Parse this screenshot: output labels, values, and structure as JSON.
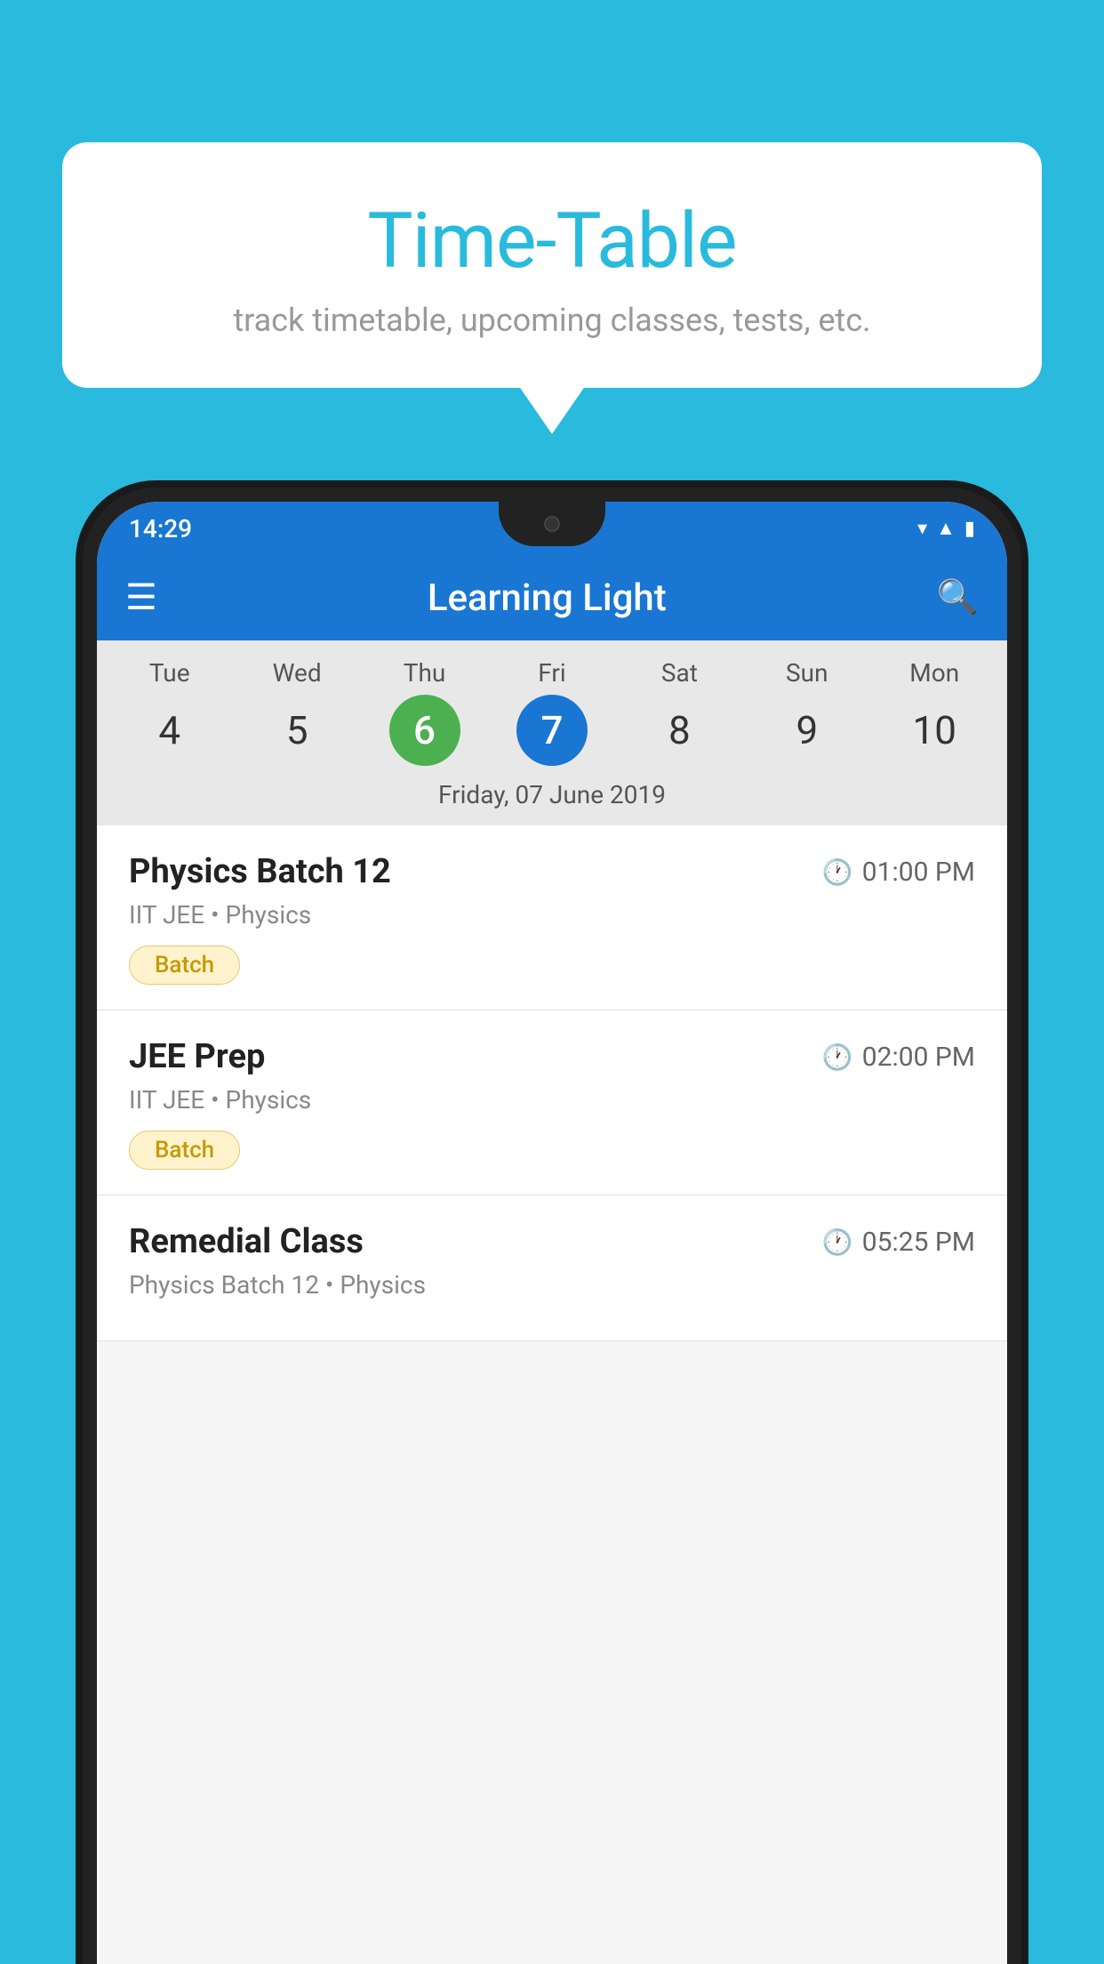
{
  "background_color": "#29BADE",
  "bubble": {
    "title": "Time-Table",
    "subtitle": "track timetable, upcoming classes, tests, etc."
  },
  "app_bar": {
    "title": "Learning Light",
    "menu_icon": "☰",
    "search_icon": "🔍"
  },
  "status_bar": {
    "time": "14:29"
  },
  "calendar": {
    "days": [
      {
        "name": "Tue",
        "number": "4",
        "state": "normal"
      },
      {
        "name": "Wed",
        "number": "5",
        "state": "normal"
      },
      {
        "name": "Thu",
        "number": "6",
        "state": "today"
      },
      {
        "name": "Fri",
        "number": "7",
        "state": "selected"
      },
      {
        "name": "Sat",
        "number": "8",
        "state": "normal"
      },
      {
        "name": "Sun",
        "number": "9",
        "state": "normal"
      },
      {
        "name": "Mon",
        "number": "10",
        "state": "normal"
      }
    ],
    "selected_date_label": "Friday, 07 June 2019"
  },
  "events": [
    {
      "name": "Physics Batch 12",
      "time": "01:00 PM",
      "subtitle": "IIT JEE • Physics",
      "badge": "Batch"
    },
    {
      "name": "JEE Prep",
      "time": "02:00 PM",
      "subtitle": "IIT JEE • Physics",
      "badge": "Batch"
    },
    {
      "name": "Remedial Class",
      "time": "05:25 PM",
      "subtitle": "Physics Batch 12 • Physics",
      "badge": null
    }
  ]
}
